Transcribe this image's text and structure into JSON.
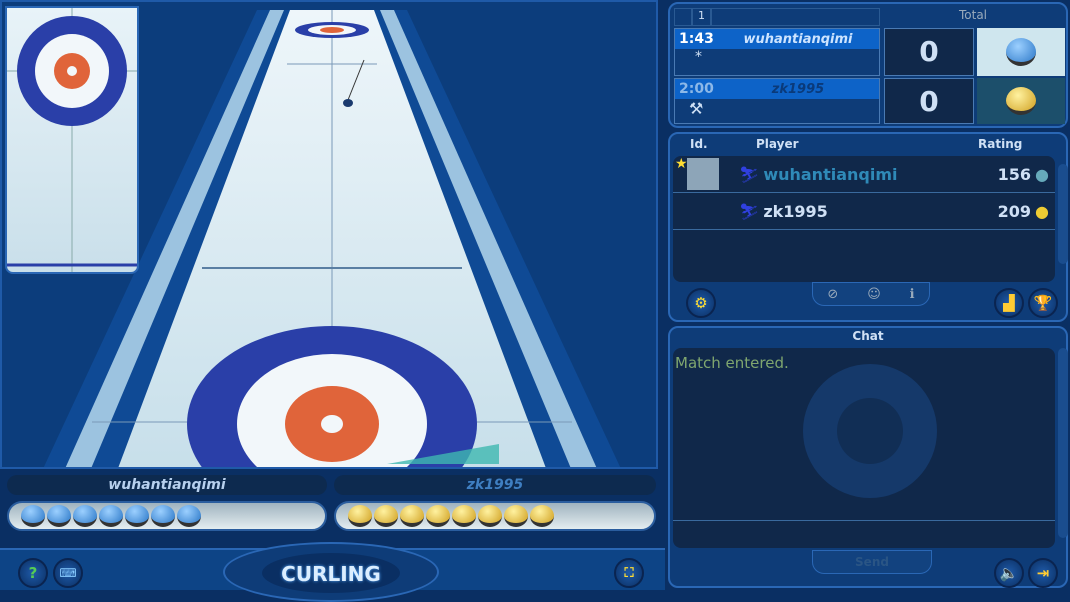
{
  "scoreboard": {
    "end_label": "1",
    "total_label": "Total",
    "players": [
      {
        "time": "1:43",
        "name": "wuhantianqimi",
        "marker": "*",
        "score": "0",
        "stone_color": "blue"
      },
      {
        "time": "2:00",
        "name": "zk1995",
        "marker": "hammer-icon",
        "score": "0",
        "stone_color": "yellow"
      }
    ]
  },
  "players_table": {
    "headers": {
      "id": "Id.",
      "player": "Player",
      "rating": "Rating"
    },
    "rows": [
      {
        "name": "wuhantianqimi",
        "rating": "156"
      },
      {
        "name": "zk1995",
        "rating": "209"
      }
    ]
  },
  "chat": {
    "title": "Chat",
    "messages": [
      "Match entered."
    ],
    "send_label": "Send"
  },
  "bottom": {
    "player1": "wuhantianqimi",
    "player2": "zk1995",
    "player1_stones": 7,
    "player2_stones": 8,
    "logo": "CURLING"
  },
  "colors": {
    "blue_ring": "#2a3fa8",
    "red_ring": "#e0643a",
    "ice": "#dcecf3",
    "panel": "#0e3c78"
  }
}
